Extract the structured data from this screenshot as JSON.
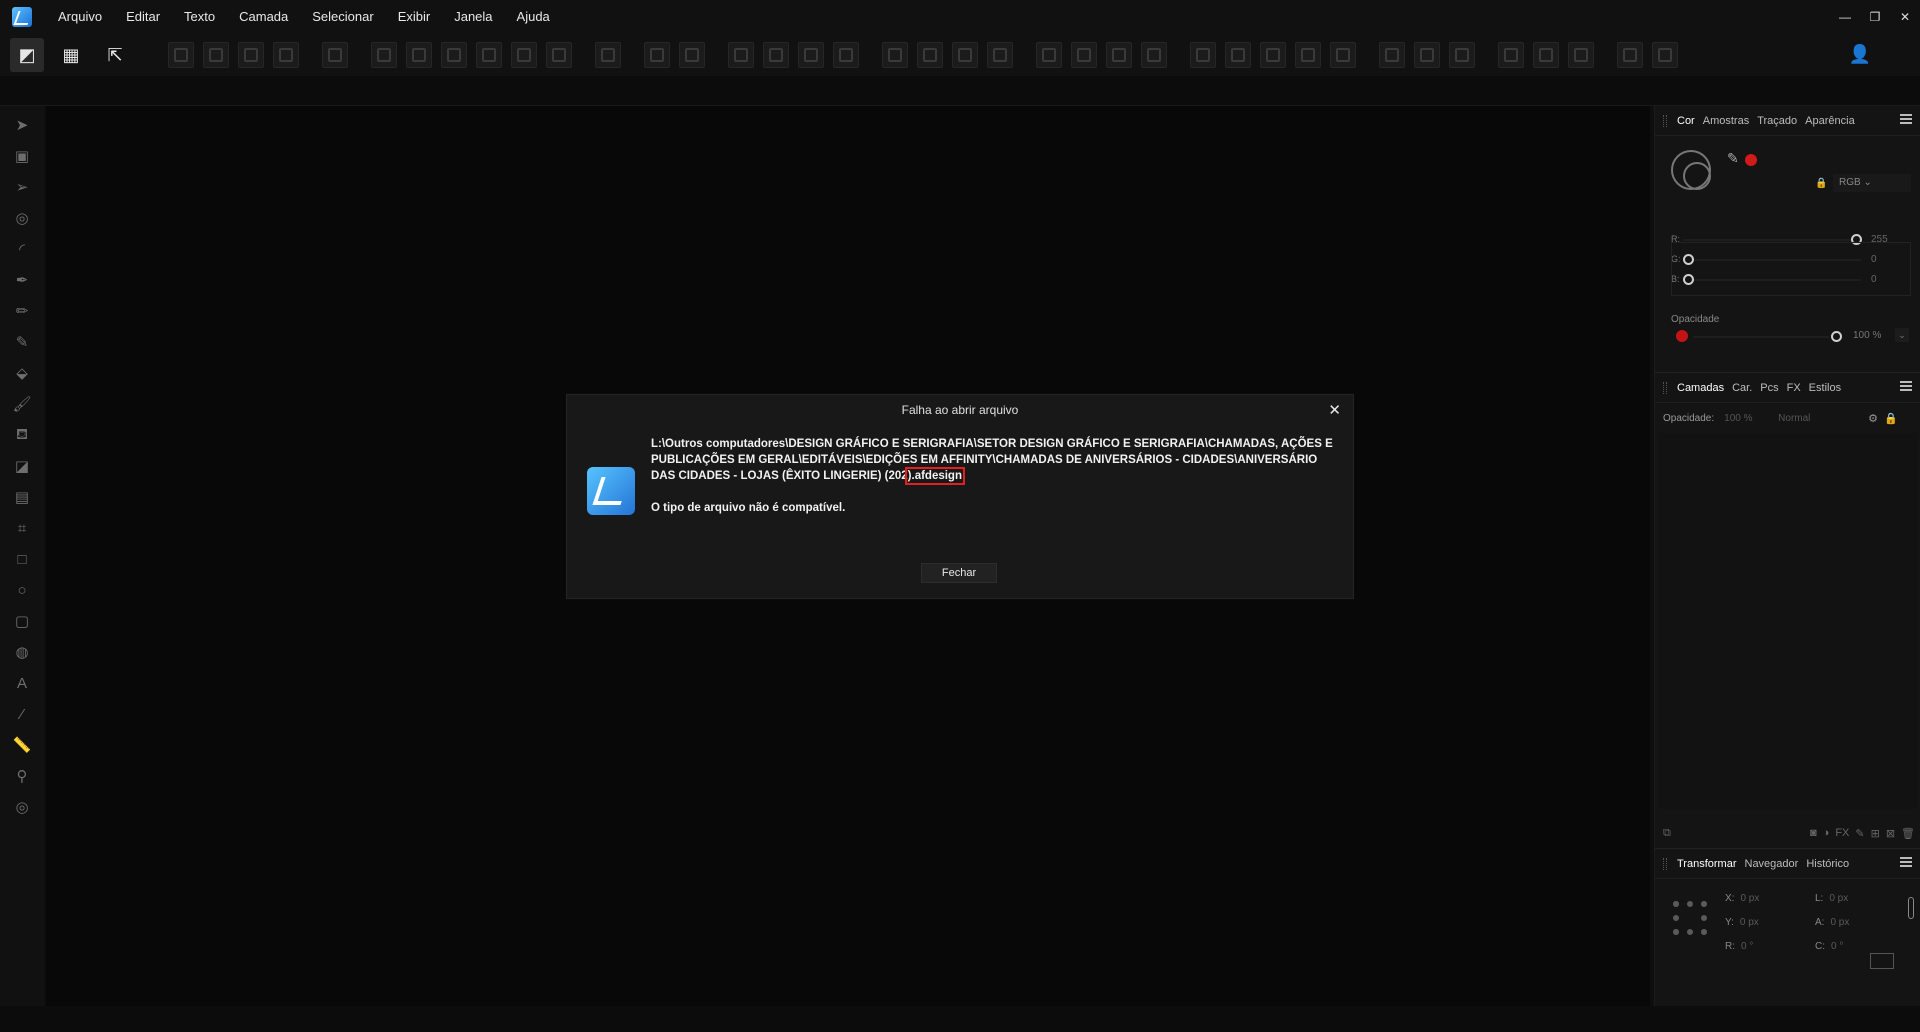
{
  "menubar": {
    "items": [
      "Arquivo",
      "Editar",
      "Texto",
      "Camada",
      "Selecionar",
      "Exibir",
      "Janela",
      "Ajuda"
    ],
    "window_controls": {
      "minimize": "—",
      "restore": "❐",
      "close": "✕"
    }
  },
  "right_panel": {
    "color_tabs": [
      "Cor",
      "Amostras",
      "Traçado",
      "Aparência"
    ],
    "color_model": "RGB",
    "sliders": [
      {
        "label": "R:",
        "value": "255",
        "level": 1.0
      },
      {
        "label": "G:",
        "value": "0",
        "level": 0.0
      },
      {
        "label": "B:",
        "value": "0",
        "level": 0.0
      }
    ],
    "opacity_label": "Opacidade",
    "opacity_value": "100 %",
    "color_swatch": "#d11a1a",
    "layers_tabs": [
      "Camadas",
      "Car.",
      "Pcs",
      "FX",
      "Estilos"
    ],
    "layers_opacity_label": "Opacidade:",
    "layers_opacity_value": "100 %",
    "layers_blend": "Normal",
    "layers_footer_fx": "FX",
    "transform_tabs": [
      "Transformar",
      "Navegador",
      "Histórico"
    ],
    "transform": {
      "x_label": "X:",
      "x_value": "0 px",
      "y_label": "Y:",
      "y_value": "0 px",
      "l_label": "L:",
      "l_value": "0 px",
      "a_label": "A:",
      "a_value": "0 px",
      "r_label": "R:",
      "r_value": "0 °",
      "c_label": "C:",
      "c_value": "0 °"
    }
  },
  "dialog": {
    "title": "Falha ao abrir arquivo",
    "close": "✕",
    "path_main": "L:\\Outros computadores\\DESIGN GRÁFICO E SERIGRAFIA\\SETOR DESIGN GRÁFICO E SERIGRAFIA\\CHAMADAS, AÇÕES E PUBLICAÇÕES EM GERAL\\EDITÁVEIS\\EDIÇÕES EM AFFINITY\\CHAMADAS DE ANIVERSÁRIOS - CIDADES\\ANIVERSÁRIO DAS CIDADES - LOJAS (ÊXITO LINGERIE) (202",
    "path_highlight": ").afdesign",
    "message": "O tipo de arquivo não é compatível.",
    "button": "Fechar"
  },
  "colors": {
    "accent_user": "#41d18a",
    "highlight_box": "#e22020",
    "app_icon": "#2f8fe8"
  }
}
